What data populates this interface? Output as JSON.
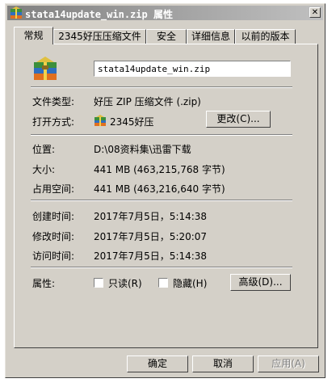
{
  "window": {
    "title": "stata14update_win.zip 属性",
    "close_glyph": "✕"
  },
  "tabs": [
    "常规",
    "2345好压压缩文件",
    "安全",
    "详细信息",
    "以前的版本"
  ],
  "general": {
    "file_name": "stata14update_win.zip",
    "file_type_label": "文件类型:",
    "file_type_value": "好压 ZIP 压缩文件 (.zip)",
    "open_with_label": "打开方式:",
    "open_with_value": "2345好压",
    "change_button": "更改(C)...",
    "location_label": "位置:",
    "location_value": "D:\\08资料集\\迅雷下载",
    "size_label": "大小:",
    "size_value": "441 MB (463,215,768 字节)",
    "size_on_disk_label": "占用空间:",
    "size_on_disk_value": "441 MB (463,216,640 字节)",
    "created_label": "创建时间:",
    "created_value": "2017年7月5日，5:14:38",
    "modified_label": "修改时间:",
    "modified_value": "2017年7月5日，5:20:07",
    "accessed_label": "访问时间:",
    "accessed_value": "2017年7月5日，5:14:38",
    "attributes_label": "属性:",
    "readonly_label": "只读(R)",
    "hidden_label": "隐藏(H)",
    "advanced_button": "高级(D)..."
  },
  "footer": {
    "ok": "确定",
    "cancel": "取消",
    "apply": "应用(A)"
  },
  "icons": {
    "title": "zip-archive-icon",
    "file": "zip-archive-icon",
    "app": "haozip-app-icon"
  }
}
